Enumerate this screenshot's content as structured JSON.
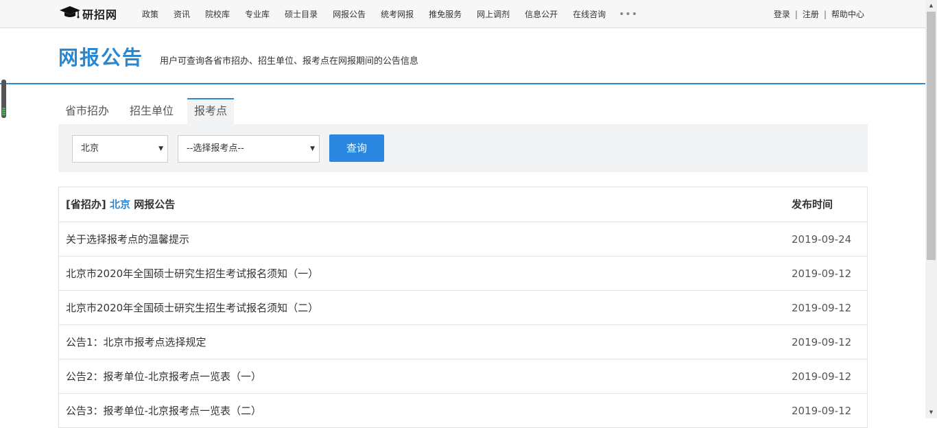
{
  "site": {
    "name": "研招网"
  },
  "nav": {
    "items": [
      "政策",
      "资讯",
      "院校库",
      "专业库",
      "硕士目录",
      "网报公告",
      "统考网报",
      "推免服务",
      "网上调剂",
      "信息公开",
      "在线咨询"
    ],
    "more": "•••"
  },
  "user_links": {
    "login": "登录",
    "register": "注册",
    "help": "帮助中心",
    "separator": "|"
  },
  "header": {
    "title": "网报公告",
    "description": "用户可查询各省市招办、招生单位、报考点在网报期间的公告信息"
  },
  "tabs": [
    "省市招办",
    "招生单位",
    "报考点"
  ],
  "filter": {
    "province": "北京",
    "point_placeholder": "--选择报考点--",
    "query_label": "查询",
    "arrow": "▼"
  },
  "table": {
    "header": {
      "prefix": "[省招办]",
      "province": "北京",
      "suffix": "网报公告",
      "date_label": "发布时间"
    },
    "rows": [
      {
        "title": "关于选择报考点的温馨提示",
        "date": "2019-09-24"
      },
      {
        "title": "北京市2020年全国硕士研究生招生考试报名须知（一）",
        "date": "2019-09-12"
      },
      {
        "title": "北京市2020年全国硕士研究生招生考试报名须知（二）",
        "date": "2019-09-12"
      },
      {
        "title": "公告1：北京市报考点选择规定",
        "date": "2019-09-12"
      },
      {
        "title": "公告2：报考单位-北京报考点一览表（一）",
        "date": "2019-09-12"
      },
      {
        "title": "公告3：报考单位-北京报考点一览表（二）",
        "date": "2019-09-12"
      }
    ]
  },
  "colors": {
    "accent": "#2a87d0",
    "button": "#2a87e0",
    "panel": "#f2f3f5"
  },
  "icons": {
    "logo": "graduation-cap-icon",
    "scroll_up": "scroll-up-arrow-icon",
    "scroll_down": "scroll-down-arrow-icon"
  },
  "scrollbar": {
    "up": "▲",
    "down": "▼"
  }
}
